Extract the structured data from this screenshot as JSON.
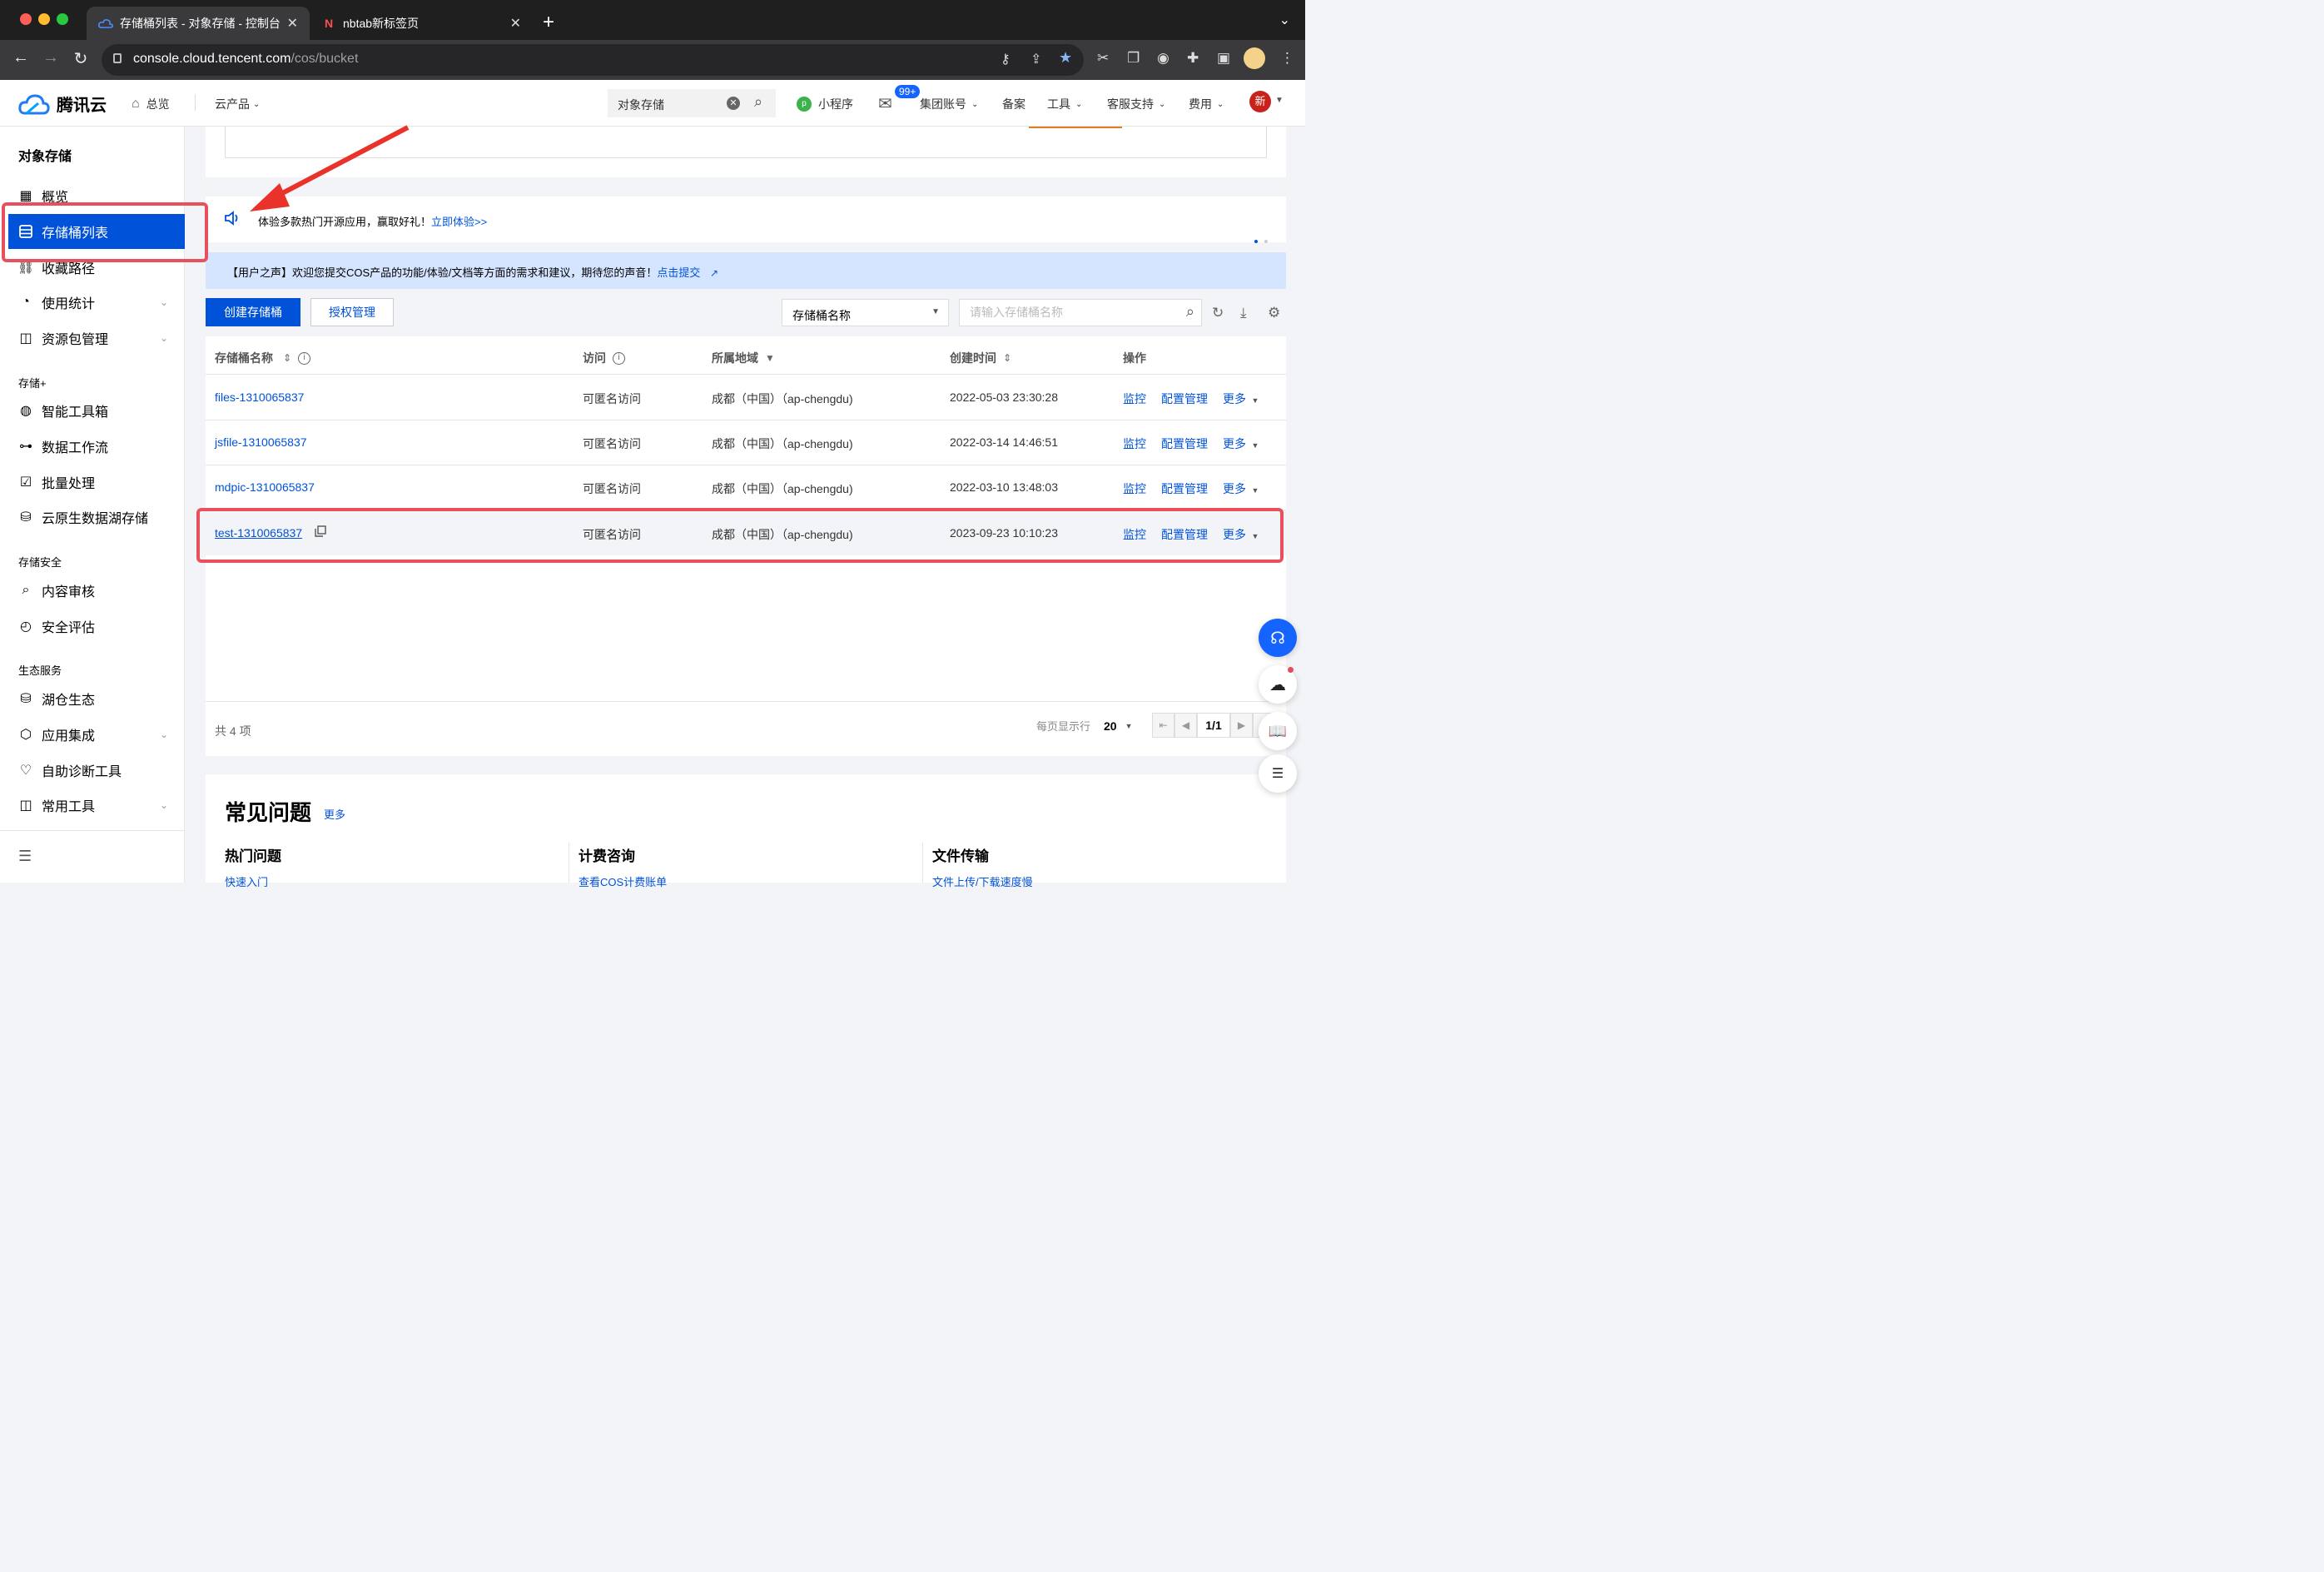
{
  "browser": {
    "tabs": [
      {
        "title": "存储桶列表 - 对象存储 - 控制台",
        "active": true
      },
      {
        "title": "nbtab新标签页",
        "active": false
      }
    ],
    "url_host": "console.cloud.tencent.com",
    "url_path": "/cos/bucket"
  },
  "header": {
    "brand": "腾讯云",
    "overview": "总览",
    "products": "云产品",
    "search_value": "对象存储",
    "mini_program": "小程序",
    "mail_badge": "99+",
    "group_account": "集团账号",
    "filing": "备案",
    "tools": "工具",
    "support": "客服支持",
    "billing": "费用",
    "avatar_text": "新"
  },
  "sidebar": {
    "title": "对象存储",
    "items": [
      {
        "label": "概览"
      },
      {
        "label": "存储桶列表"
      },
      {
        "label": "收藏路径"
      },
      {
        "label": "使用统计"
      },
      {
        "label": "资源包管理"
      }
    ],
    "group_storage_plus": "存储+",
    "storage_plus": [
      {
        "label": "智能工具箱"
      },
      {
        "label": "数据工作流"
      },
      {
        "label": "批量处理"
      },
      {
        "label": "云原生数据湖存储"
      }
    ],
    "group_security": "存储安全",
    "security": [
      {
        "label": "内容审核"
      },
      {
        "label": "安全评估"
      }
    ],
    "group_eco": "生态服务",
    "eco": [
      {
        "label": "湖仓生态"
      },
      {
        "label": "应用集成"
      },
      {
        "label": "自助诊断工具"
      },
      {
        "label": "常用工具"
      }
    ]
  },
  "notice": {
    "text": "体验多款热门开源应用，赢取好礼！",
    "link": "立即体验>>"
  },
  "voice": {
    "text": "【用户之声】欢迎您提交COS产品的功能/体验/文档等方面的需求和建议，期待您的声音！",
    "link": "点击提交"
  },
  "toolbar": {
    "create": "创建存储桶",
    "auth": "授权管理",
    "filter_select": "存储桶名称",
    "search_placeholder": "请输入存储桶名称"
  },
  "table": {
    "headers": {
      "name": "存储桶名称",
      "access": "访问",
      "region": "所属地域",
      "created": "创建时间",
      "ops": "操作"
    },
    "rows": [
      {
        "name": "files-1310065837",
        "access": "可匿名访问",
        "region": "成都（中国）（ap-chengdu)",
        "created": "2022-05-03 23:30:28"
      },
      {
        "name": "jsfile-1310065837",
        "access": "可匿名访问",
        "region": "成都（中国）（ap-chengdu)",
        "created": "2022-03-14 14:46:51"
      },
      {
        "name": "mdpic-1310065837",
        "access": "可匿名访问",
        "region": "成都（中国）（ap-chengdu)",
        "created": "2022-03-10 13:48:03"
      },
      {
        "name": "test-1310065837",
        "access": "可匿名访问",
        "region": "成都（中国）（ap-chengdu)",
        "created": "2023-09-23 10:10:23"
      }
    ],
    "op_monitor": "监控",
    "op_config": "配置管理",
    "op_more": "更多",
    "total": "共 4 项",
    "per_page_label": "每页显示行",
    "per_page": "20",
    "page": "1/1"
  },
  "faq": {
    "title": "常见问题",
    "more": "更多",
    "cols": [
      {
        "title": "热门问题",
        "link": "快速入门"
      },
      {
        "title": "计费咨询",
        "link": "查看COS计费账单"
      },
      {
        "title": "文件传输",
        "link": "文件上传/下载速度慢"
      }
    ]
  },
  "colors": {
    "primary": "#0052d9",
    "annotation": "#e8505b"
  }
}
